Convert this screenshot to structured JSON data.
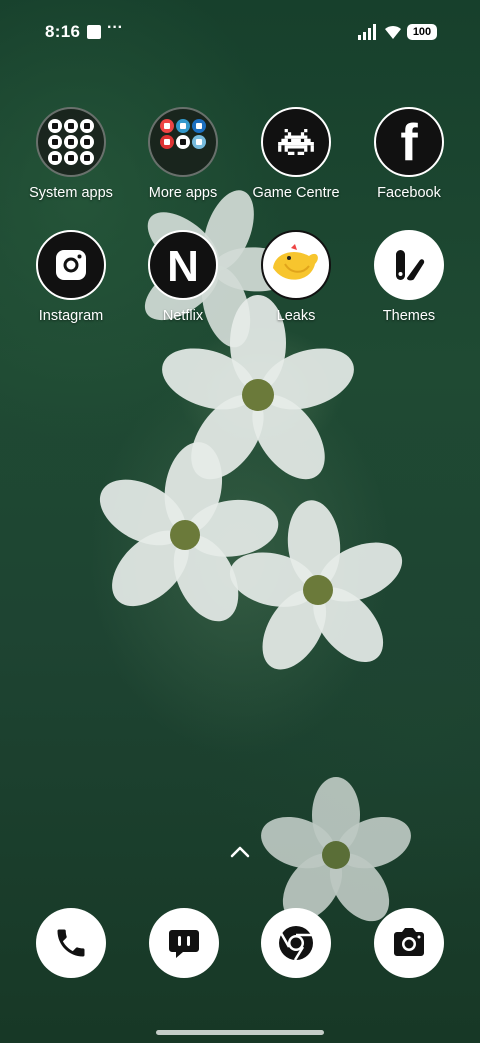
{
  "status_bar": {
    "time": "8:16",
    "extra": "···",
    "battery": "100"
  },
  "apps": [
    {
      "label": "System apps",
      "icon": "folder-icon"
    },
    {
      "label": "More apps",
      "icon": "folder-icon"
    },
    {
      "label": "Game Centre",
      "icon": "space-invader-icon"
    },
    {
      "label": "Facebook",
      "icon": "facebook-icon"
    },
    {
      "label": "Instagram",
      "icon": "instagram-icon"
    },
    {
      "label": "Netflix",
      "icon": "netflix-icon"
    },
    {
      "label": "Leaks",
      "icon": "bird-icon"
    },
    {
      "label": "Themes",
      "icon": "themes-icon"
    }
  ],
  "dock": [
    "phone-icon",
    "messages-icon",
    "chrome-icon",
    "camera-icon"
  ],
  "colors": {
    "wallpaper": "#1f4a33",
    "icon_dark": "#111111",
    "icon_light": "#ffffff",
    "leaks_yellow": "#f7c52e"
  }
}
